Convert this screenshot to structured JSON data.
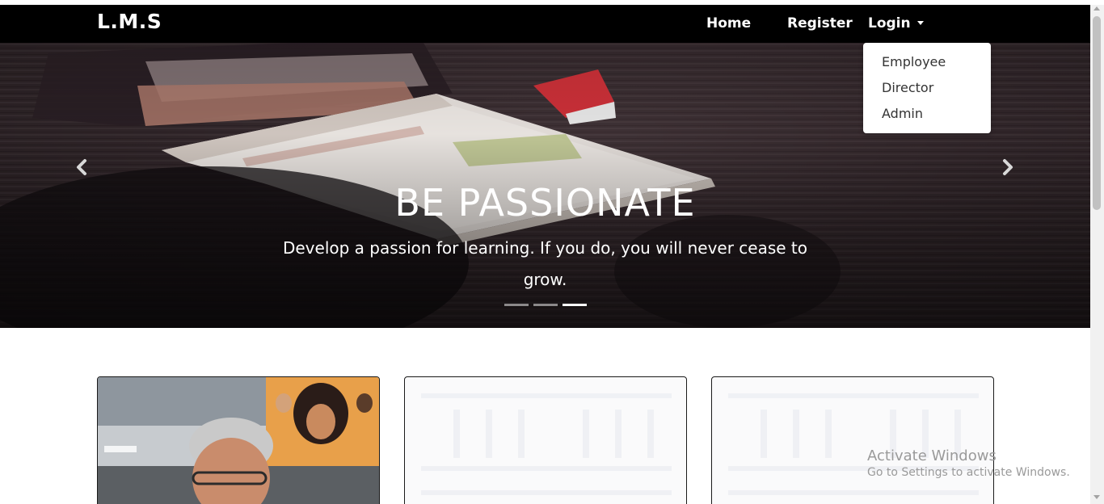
{
  "navbar": {
    "brand": "L.M.S",
    "links": {
      "home": "Home",
      "register": "Register",
      "login": "Login"
    }
  },
  "login_dropdown": {
    "items": [
      "Employee",
      "Director",
      "Admin"
    ]
  },
  "carousel": {
    "title": "BE PASSIONATE",
    "text": "Develop a passion for learning. If you do, you will never cease to grow.",
    "slide_count": 3,
    "active_slide": 3,
    "prev_icon": "chevron-left-icon",
    "next_icon": "chevron-right-icon"
  },
  "cards": [
    {
      "image": "director-photo"
    },
    {
      "image": "blank-pattern"
    },
    {
      "image": "blank-pattern"
    }
  ],
  "windows_watermark": {
    "title": "Activate Windows",
    "subtitle": "Go to Settings to activate Windows."
  },
  "colors": {
    "navbar": "#000000",
    "dropdown_bg": "#ffffff",
    "text_light": "#ffffff"
  }
}
